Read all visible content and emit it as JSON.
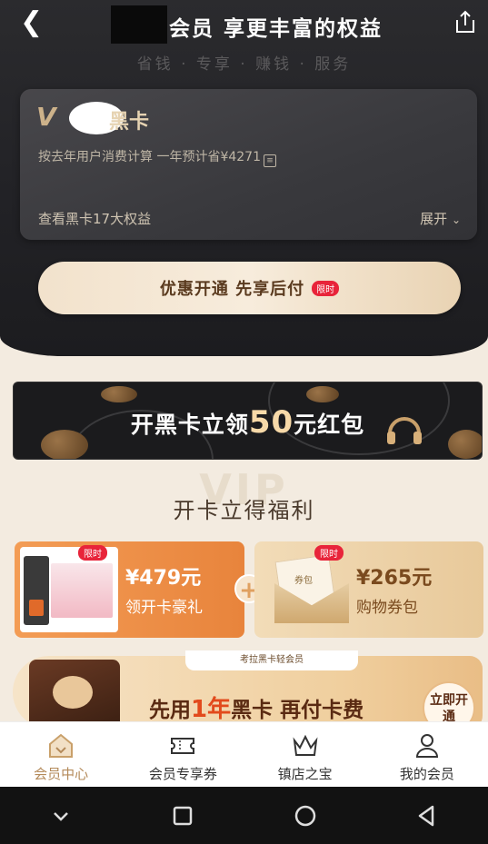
{
  "header": {
    "title": "会员 享更丰富的权益",
    "tagline": "省钱 · 专享 · 赚钱 · 服务"
  },
  "card": {
    "v_mark": "V",
    "name": "黑卡",
    "savings_text": "按去年用户消费计算 一年预计省¥4271",
    "benefits_link": "查看黑卡17大权益",
    "expand_label": "展开"
  },
  "cta": {
    "label": "优惠开通 先享后付",
    "badge": "限时"
  },
  "banner": {
    "text_prefix": "开黑卡立领",
    "amount": "50",
    "text_suffix": "元红包"
  },
  "section": {
    "bg_word": "VIP",
    "title": "开卡立得福利"
  },
  "offers": [
    {
      "badge": "限时",
      "price": "¥479元",
      "label": "领开卡豪礼"
    },
    {
      "badge": "限时",
      "price": "¥265元",
      "label": "购物券包",
      "coupon_text": "券包"
    }
  ],
  "promo": {
    "tag": "考拉黑卡轻会员",
    "text_prefix": "先用",
    "highlight": "1年",
    "text_suffix": "黑卡 再付卡费",
    "button": "立即开通"
  },
  "tabs": [
    {
      "label": "会员中心",
      "icon": "member-home-icon",
      "active": true
    },
    {
      "label": "会员专享券",
      "icon": "ticket-icon",
      "active": false
    },
    {
      "label": "镇店之宝",
      "icon": "crown-icon",
      "active": false
    },
    {
      "label": "我的会员",
      "icon": "user-icon",
      "active": false
    }
  ],
  "colors": {
    "gold": "#b48a5a",
    "badge_red": "#e8243a",
    "dark_bg": "#222226"
  }
}
